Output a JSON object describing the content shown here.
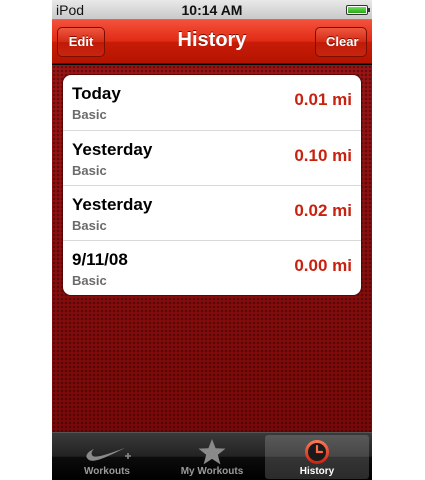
{
  "status_bar": {
    "carrier": "iPod",
    "time": "10:14 AM"
  },
  "nav_bar": {
    "title": "History",
    "left_button": "Edit",
    "right_button": "Clear"
  },
  "history": {
    "rows": [
      {
        "date": "Today",
        "type": "Basic",
        "distance": "0.01 mi"
      },
      {
        "date": "Yesterday",
        "type": "Basic",
        "distance": "0.10 mi"
      },
      {
        "date": "Yesterday",
        "type": "Basic",
        "distance": "0.02 mi"
      },
      {
        "date": "9/11/08",
        "type": "Basic",
        "distance": "0.00 mi"
      }
    ]
  },
  "tab_bar": {
    "tabs": [
      {
        "label": "Workouts",
        "icon": "nike-plus-icon"
      },
      {
        "label": "My Workouts",
        "icon": "star-icon"
      },
      {
        "label": "History",
        "icon": "clock-icon"
      }
    ],
    "selected": "History"
  },
  "colors": {
    "accent_red": "#c8210f",
    "nav_red": "#e02a14",
    "background_red": "#8c0d0d"
  }
}
